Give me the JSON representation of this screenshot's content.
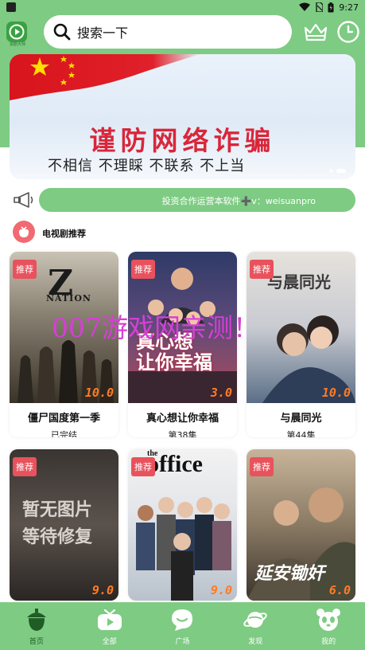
{
  "status_bar": {
    "time": "9:27"
  },
  "app": {
    "logo_text": "追剧大师"
  },
  "search": {
    "placeholder": "搜索一下"
  },
  "banner": {
    "title": "谨防网络诈骗",
    "subtitle": "不相信  不理睬  不联系  不上当"
  },
  "notice": {
    "text": "投资合作运营本软件➕v：weisuanpro"
  },
  "section": {
    "title": "电视剧推荐"
  },
  "watermark": "007游戏网亲测！",
  "cards": [
    {
      "badge": "推荐",
      "score": "10.0",
      "title": "僵尸国度第一季",
      "subtitle": "已完结",
      "poster_text": "Z\nNATION"
    },
    {
      "badge": "推荐",
      "score": "3.0",
      "title": "真心想让你幸福",
      "subtitle": "第38集",
      "poster_text": "真心想让你幸福"
    },
    {
      "badge": "推荐",
      "score": "10.0",
      "title": "与晨同光",
      "subtitle": "第44集",
      "poster_text": "与晨同光"
    },
    {
      "badge": "推荐",
      "score": "9.0",
      "title": "",
      "subtitle": "",
      "poster_text": "暂无图片\n等待修复"
    },
    {
      "badge": "推荐",
      "score": "9.0",
      "title": "",
      "subtitle": "",
      "poster_text": "the office"
    },
    {
      "badge": "推荐",
      "score": "6.0",
      "title": "",
      "subtitle": "",
      "poster_text": "延安锄奸"
    }
  ],
  "bottom_nav": [
    {
      "label": "首页",
      "icon": "acorn-icon",
      "active": true
    },
    {
      "label": "全部",
      "icon": "tv-icon",
      "active": false
    },
    {
      "label": "广场",
      "icon": "chat-bubble-icon",
      "active": false
    },
    {
      "label": "发现",
      "icon": "planet-icon",
      "active": false
    },
    {
      "label": "我的",
      "icon": "panda-icon",
      "active": false
    }
  ],
  "colors": {
    "brand_green": "#7ecb83",
    "badge_red": "#e8525c",
    "score_orange": "#ff7b24",
    "watermark": "#d63fd6"
  }
}
